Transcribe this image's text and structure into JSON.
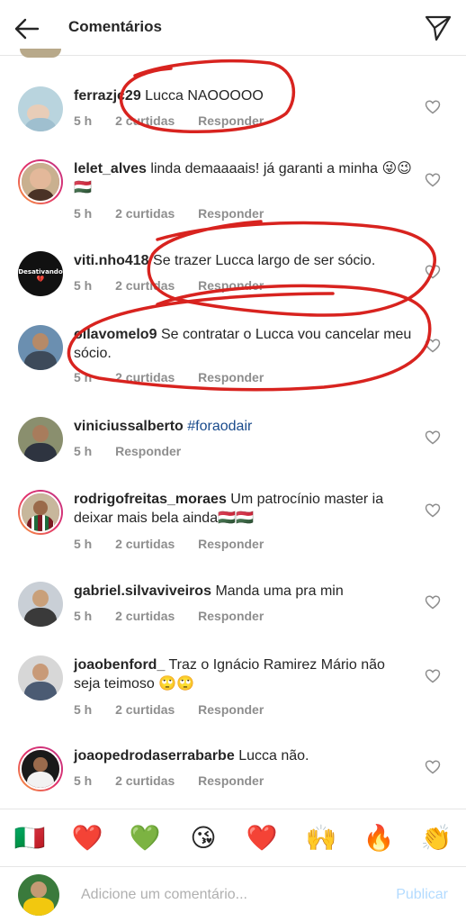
{
  "header": {
    "title": "Comentários",
    "back_icon": "arrow-left-icon",
    "send_icon": "paper-plane-icon"
  },
  "colors": {
    "annotation": "#d8231f",
    "meta": "#8e8e8e",
    "hashtag": "#1a4b8c",
    "publish": "#b3dbff"
  },
  "comments": [
    {
      "username": "ferrazjc29",
      "text": "Lucca NAOOOOO",
      "time": "5 h",
      "likes": "2 curtidas",
      "reply": "Responder"
    },
    {
      "username": "lelet_alves",
      "text": "linda demaaaais! já garanti a minha 😜😉🇭🇺",
      "time": "5 h",
      "likes": "2 curtidas",
      "reply": "Responder"
    },
    {
      "username": "viti.nho418",
      "text": "Se trazer Lucca largo de ser sócio.",
      "time": "5 h",
      "likes": "2 curtidas",
      "reply": "Responder",
      "avatar_text": "Desativando💔"
    },
    {
      "username": "ollavomelo9",
      "text": "Se contratar o Lucca vou cancelar meu sócio.",
      "time": "5 h",
      "likes": "2 curtidas",
      "reply": "Responder"
    },
    {
      "username": "viniciussalberto",
      "text": "#foraodair",
      "time": "5 h",
      "likes": "",
      "reply": "Responder"
    },
    {
      "username": "rodrigofreitas_moraes",
      "text": "Um patrocínio master ia deixar mais bela ainda🇭🇺🇭🇺",
      "time": "5 h",
      "likes": "2 curtidas",
      "reply": "Responder"
    },
    {
      "username": "gabriel.silvaviveiros",
      "text": "Manda uma pra min",
      "time": "5 h",
      "likes": "2 curtidas",
      "reply": "Responder"
    },
    {
      "username": "joaobenford_",
      "text": "Traz o Ignácio Ramirez Mário não seja teimoso 🙄🙄",
      "time": "5 h",
      "likes": "2 curtidas",
      "reply": "Responder"
    },
    {
      "username": "joaopedrodaserrabarbe",
      "text": "Lucca não.",
      "time": "5 h",
      "likes": "2 curtidas",
      "reply": "Responder"
    }
  ],
  "emoji_bar": [
    "🇮🇹",
    "❤️",
    "💚",
    "😘",
    "❤️",
    "🙌",
    "🔥",
    "👏"
  ],
  "compose": {
    "placeholder": "Adicione um comentário...",
    "publish_label": "Publicar"
  }
}
